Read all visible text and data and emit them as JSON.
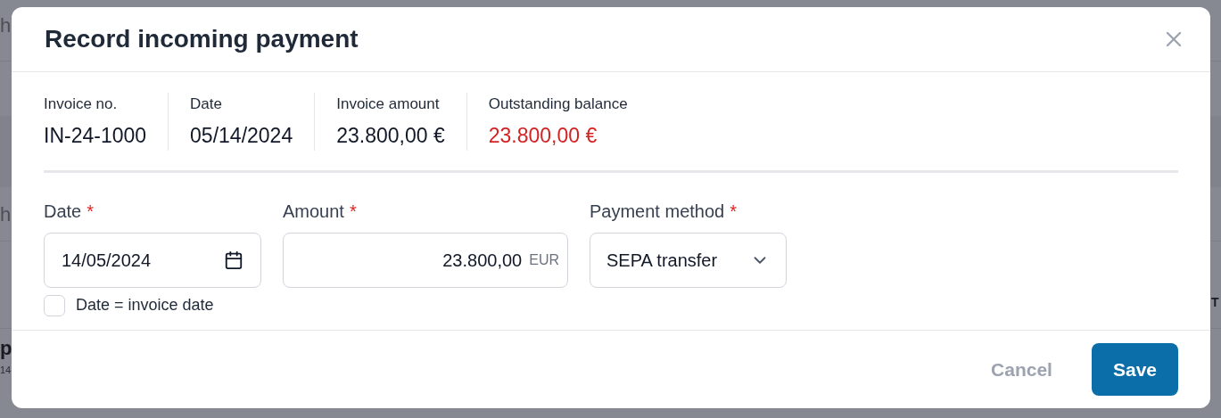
{
  "background": {
    "left_fragments": [
      {
        "text": "h",
        "kind": "muted"
      },
      {
        "text": "h",
        "kind": "muted"
      },
      {
        "text": "p",
        "kind": "strong"
      },
      {
        "text": "14",
        "kind": "small"
      }
    ],
    "right_fragments": [
      {
        "text": "T",
        "kind": "edge"
      }
    ]
  },
  "dialog": {
    "title": "Record incoming payment",
    "summary": [
      {
        "label": "Invoice no.",
        "value": "IN-24-1000",
        "color": "#111827"
      },
      {
        "label": "Date",
        "value": "05/14/2024",
        "color": "#111827"
      },
      {
        "label": "Invoice amount",
        "value": "23.800,00 €",
        "color": "#111827"
      },
      {
        "label": "Outstanding balance",
        "value": "23.800,00 €",
        "color": "#d32222"
      }
    ],
    "fields": [
      {
        "kind": "date",
        "label": "Date",
        "required_mark": "*",
        "value": "14/05/2024"
      },
      {
        "kind": "amount",
        "label": "Amount",
        "required_mark": "*",
        "value": "23.800,00",
        "unit": "EUR"
      },
      {
        "kind": "select",
        "label": "Payment method",
        "required_mark": "*",
        "value": "SEPA transfer"
      }
    ],
    "checkbox": {
      "label": "Date = invoice date",
      "checked": false
    },
    "buttons": [
      {
        "label": "Cancel",
        "kind": "secondary"
      },
      {
        "label": "Save",
        "kind": "primary"
      }
    ]
  }
}
